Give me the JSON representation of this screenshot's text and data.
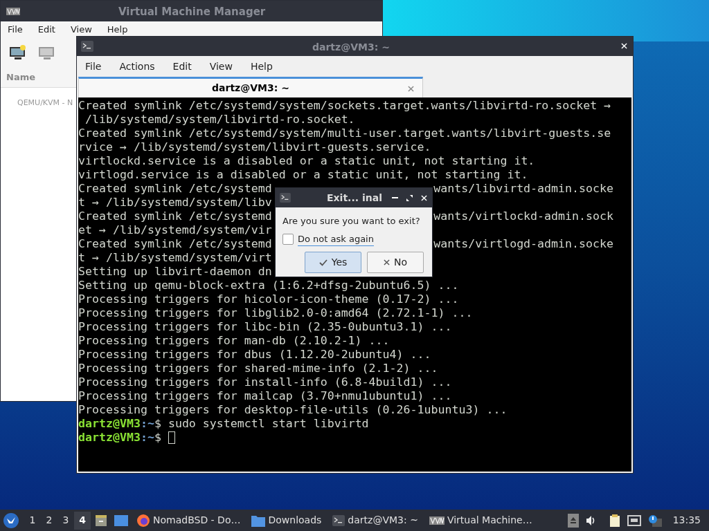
{
  "vmm_window": {
    "title": "Virtual Machine Manager",
    "menu": [
      "File",
      "Edit",
      "View",
      "Help"
    ],
    "column": "Name",
    "rows": [
      "QEMU/KVM - N"
    ]
  },
  "terminal_window": {
    "title": "dartz@VM3: ~",
    "menu": [
      "File",
      "Actions",
      "Edit",
      "View",
      "Help"
    ],
    "tabs": [
      {
        "label": "dartz@VM3: ~",
        "selected": true
      }
    ],
    "lines": [
      {
        "kind": "output",
        "text": "Created symlink /etc/systemd/system/sockets.target.wants/libvirtd-ro.socket →"
      },
      {
        "kind": "output",
        "text": " /lib/systemd/system/libvirtd-ro.socket."
      },
      {
        "kind": "output",
        "text": "Created symlink /etc/systemd/system/multi-user.target.wants/libvirt-guests.se"
      },
      {
        "kind": "output",
        "text": "rvice → /lib/systemd/system/libvirt-guests.service."
      },
      {
        "kind": "output",
        "text": "virtlockd.service is a disabled or a static unit, not starting it."
      },
      {
        "kind": "output",
        "text": "virtlogd.service is a disabled or a static unit, not starting it."
      },
      {
        "kind": "output",
        "text": "Created symlink /etc/systemd",
        "right": "wants/libvirtd-admin.socke"
      },
      {
        "kind": "output",
        "text": "t → /lib/systemd/system/libv"
      },
      {
        "kind": "output",
        "text": "Created symlink /etc/systemd",
        "right": "wants/virtlockd-admin.sock"
      },
      {
        "kind": "output",
        "text": "et → /lib/systemd/system/vir"
      },
      {
        "kind": "output",
        "text": "Created symlink /etc/systemd",
        "right": "wants/virtlogd-admin.socke"
      },
      {
        "kind": "output",
        "text": "t → /lib/systemd/system/virt"
      },
      {
        "kind": "output",
        "text": "Setting up libvirt-daemon dn"
      },
      {
        "kind": "output",
        "text": "Setting up qemu-block-extra (1:6.2+dfsg-2ubuntu6.5) ..."
      },
      {
        "kind": "output",
        "text": "Processing triggers for hicolor-icon-theme (0.17-2) ..."
      },
      {
        "kind": "output",
        "text": "Processing triggers for libglib2.0-0:amd64 (2.72.1-1) ..."
      },
      {
        "kind": "output",
        "text": "Processing triggers for libc-bin (2.35-0ubuntu3.1) ..."
      },
      {
        "kind": "output",
        "text": "Processing triggers for man-db (2.10.2-1) ..."
      },
      {
        "kind": "output",
        "text": "Processing triggers for dbus (1.12.20-2ubuntu4) ..."
      },
      {
        "kind": "output",
        "text": "Processing triggers for shared-mime-info (2.1-2) ..."
      },
      {
        "kind": "output",
        "text": "Processing triggers for install-info (6.8-4build1) ..."
      },
      {
        "kind": "output",
        "text": "Processing triggers for mailcap (3.70+nmu1ubuntu1) ..."
      },
      {
        "kind": "output",
        "text": "Processing triggers for desktop-file-utils (0.26-1ubuntu3) ..."
      },
      {
        "kind": "prompt",
        "user": "dartz@VM3",
        "path": ":~",
        "sign": "$",
        "text": " sudo systemctl start libvirtd"
      },
      {
        "kind": "prompt",
        "user": "dartz@VM3",
        "path": ":~",
        "sign": "$",
        "cursor": true
      }
    ]
  },
  "dialog": {
    "title": "Exit... inal",
    "message": "Are you sure you want to exit?",
    "checkbox": {
      "label": "Do not ask again",
      "checked": false
    },
    "buttons": [
      {
        "label": "Yes",
        "kind": "confirm",
        "default": true
      },
      {
        "label": "No",
        "kind": "cancel",
        "default": false
      }
    ]
  },
  "taskbar": {
    "workspaces": [
      {
        "label": "1",
        "selected": false
      },
      {
        "label": "2",
        "selected": false
      },
      {
        "label": "3",
        "selected": false
      },
      {
        "label": "4",
        "selected": true
      }
    ],
    "tasks": [
      {
        "label": "NomadBSD - Do…",
        "kind": "browser"
      },
      {
        "label": "Downloads",
        "kind": "folder"
      },
      {
        "label": "dartz@VM3: ~",
        "kind": "terminal"
      },
      {
        "label": "Virtual Machine…",
        "kind": "vmm"
      }
    ],
    "clock": "13:35"
  }
}
